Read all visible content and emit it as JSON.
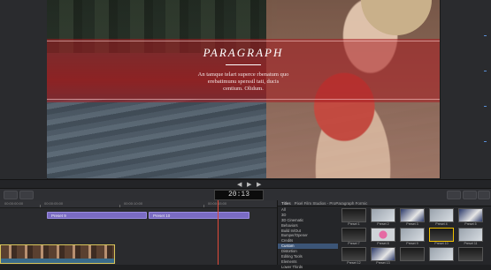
{
  "viewer": {
    "title": "PARAGRAPH",
    "paragraph_lines": [
      "An tamque telart superce rbenatum quo",
      "erebatimunu sperssil tati, ducis",
      "centium. Olidum."
    ]
  },
  "transport": {
    "play": "▶",
    "prev": "◀",
    "next": "▶"
  },
  "timeline": {
    "timecode": "20:13",
    "ruler": [
      "00:00:00:00",
      "00:00:05:00",
      "00:00:10:00",
      "00:00:15:00"
    ],
    "clips": [
      "Preset 9",
      "Preset 10"
    ]
  },
  "browser": {
    "header": "Titles",
    "path": "Pixel Film Studios - ProParagraph Formic",
    "categories": [
      "All",
      "3D",
      "3D Cinematic",
      "Behaviors",
      "Build In/Out",
      "Bumper/Opener",
      "Credits",
      "Custom",
      "Distortion",
      "Editing Tools",
      "Elements",
      "Lower Thirds"
    ],
    "thumbs": [
      {
        "label": "Preset 1",
        "style": "dark"
      },
      {
        "label": "Preset 2",
        "style": "bright"
      },
      {
        "label": "Preset 3",
        "style": "blue"
      },
      {
        "label": "Preset 4",
        "style": "bright"
      },
      {
        "label": "Preset 5",
        "style": "blue"
      },
      {
        "label": "Preset 7",
        "style": "dark"
      },
      {
        "label": "Preset 8",
        "style": "pink"
      },
      {
        "label": "Preset 9",
        "style": "bright"
      },
      {
        "label": "Preset 10",
        "style": "dark"
      },
      {
        "label": "Preset 11",
        "style": "bright"
      },
      {
        "label": "Preset 12",
        "style": "dark"
      },
      {
        "label": "Preset 13",
        "style": "blue"
      },
      {
        "label": "",
        "style": "dark"
      },
      {
        "label": "",
        "style": "bright"
      },
      {
        "label": "",
        "style": "dark"
      }
    ]
  }
}
